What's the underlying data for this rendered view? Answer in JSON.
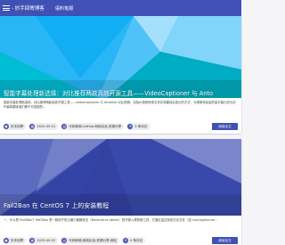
{
  "header": {
    "brand": "- 妙手回寄博客",
    "nav_link": "语料笔报"
  },
  "posts": [
    {
      "title": "智能字幕处理新选择：对比推荐两款高效开源工具——VideoCaptioner 与 Anto",
      "excerpt": "智能字幕处理新选择，对比推荐两款高效开源工具——VideoCaptioner 与 AntoSub 对比视频。包括AI语音转录文本并将翻译后显示的方式，为视频添加高质量字幕已成为创作者和翻译者们都不可或缺的...",
      "author": "妙手回寄",
      "date": "2025-09-01",
      "category": "代码新闻,GitHub,网络杂谈,资源分享",
      "comments": "0 条评论",
      "read_more": "阅读全文"
    },
    {
      "title": "Fail2Ban 在 CentOS 7 上的安装教程",
      "excerpt": "一、什么是 Fail2Ban？Fail2Ban 是一款用于防止暴力破解攻击（Brute-force attack）的开源入侵防御工具，它通过监控系统日志文件（如 /var/log/secure...",
      "author": "妙手回寄",
      "date": "2025-09-02",
      "category": "代码新闻,网络杂谈,资源分享,网站",
      "comments": "0 条评论",
      "read_more": "阅读全文"
    }
  ],
  "colors": {
    "primary": "#3f51b5",
    "hero1_base": "#1e88e5",
    "hero2_base": "#3949ab"
  }
}
